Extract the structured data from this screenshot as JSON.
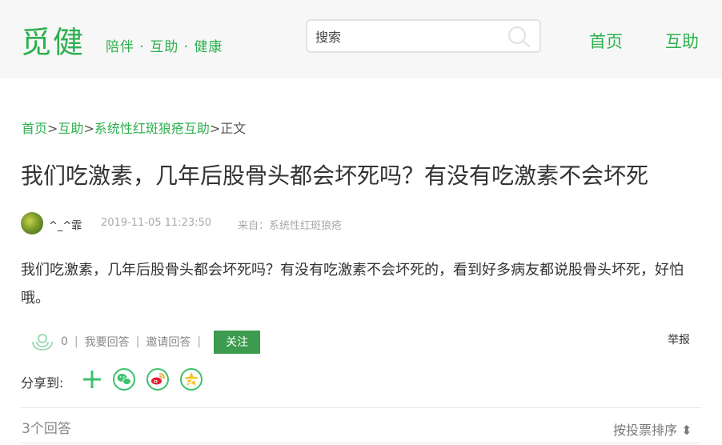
{
  "header": {
    "logo_text": "觅健",
    "slogan": "陪伴 · 互助 · 健康",
    "search_placeholder": "搜索",
    "nav": [
      {
        "label": "首页"
      },
      {
        "label": "互助"
      }
    ]
  },
  "breadcrumb": {
    "items": [
      "首页",
      "互助",
      "系统性红斑狼疮互助"
    ],
    "separator": ">",
    "current": "正文"
  },
  "post": {
    "title": "我们吃激素，几年后股骨头都会坏死吗？有没有吃激素不会坏死",
    "author": "^_^霏",
    "datetime": "2019-11-05 11:23:50",
    "source": "来自：系统性红斑狼疮",
    "content": "我们吃激素，几年后股骨头都会坏死吗？有没有吃激素不会坏死的，看到好多病友都说股骨头坏死，好怕哦。"
  },
  "actions": {
    "like_count": "0",
    "answer_label": "我要回答",
    "invite_label": "邀请回答",
    "separator": "|",
    "follow_label": "关注",
    "report_label": "举报"
  },
  "share": {
    "label": "分享到:",
    "icons": [
      "plus-icon",
      "wechat-icon",
      "weibo-icon",
      "qzone-icon"
    ]
  },
  "answers": {
    "count_label": "3个回答",
    "sort_label": "按投票排序 ⬍"
  },
  "colors": {
    "brand_green": "#2db04f",
    "button_green": "#3c9b4e",
    "header_bg": "#f7f7f7"
  }
}
